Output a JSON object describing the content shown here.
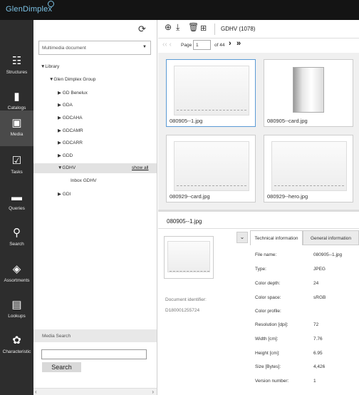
{
  "app": {
    "brand": "GlenDimplex"
  },
  "nav": {
    "items": [
      {
        "label": "Structures",
        "icon": "structures-icon"
      },
      {
        "label": "Catalogs",
        "icon": "catalogs-icon"
      },
      {
        "label": "Media",
        "icon": "media-icon"
      },
      {
        "label": "Tasks",
        "icon": "tasks-icon"
      },
      {
        "label": "Queries",
        "icon": "queries-icon"
      },
      {
        "label": "Search",
        "icon": "search-icon"
      },
      {
        "label": "Assortments",
        "icon": "assortments-icon"
      },
      {
        "label": "Lookups",
        "icon": "lookups-icon"
      },
      {
        "label": "Characteristic",
        "icon": "characteristic-icon"
      }
    ],
    "active": "Media"
  },
  "tree": {
    "doc_type": "Multimedia document",
    "nodes": {
      "library": "▼Library",
      "glen": "▼Glen Dimplex Group",
      "benelux": "▶ GD Benelux",
      "gda": "▶ GDA",
      "gdcaha": "▶ GDCAHA",
      "gdcamr": "▶ GDCAMR",
      "gdcarr": "▶ GDCARR",
      "gdd": "▶ GDD",
      "gdhv": "▼GDHV",
      "inbox": "Inbox GDHV",
      "gdi": "▶ GDI"
    },
    "show_all": "show all"
  },
  "search": {
    "header": "Media Search",
    "button": "Search",
    "value": ""
  },
  "toolbar": {
    "title": "GDHV (1078)"
  },
  "pager": {
    "page_label": "Page",
    "page": "1",
    "of": "of 44"
  },
  "thumbs": [
    {
      "label": "080905--1.jpg",
      "selected": true
    },
    {
      "label": "080905--card.jpg",
      "selected": false
    },
    {
      "label": "080929--card.jpg",
      "selected": false
    },
    {
      "label": "080929--hero.jpg",
      "selected": false
    }
  ],
  "detail": {
    "title": "080905--1.jpg",
    "doc_id_label": "Document identifier:",
    "doc_id": "D180001255724",
    "tab_technical": "Technical information",
    "tab_general": "General information",
    "props": [
      {
        "label": "File name:",
        "value": "080905--1.jpg"
      },
      {
        "label": "Type:",
        "value": "JPEG"
      },
      {
        "label": "Color depth:",
        "value": "24"
      },
      {
        "label": "Color space:",
        "value": "sRGB"
      },
      {
        "label": "Color profile:",
        "value": ""
      },
      {
        "label": "Resolution [dpi]:",
        "value": "72"
      },
      {
        "label": "Width [cm]:",
        "value": "7.76"
      },
      {
        "label": "Height [cm]:",
        "value": "6.95"
      },
      {
        "label": "Size [Bytes]:",
        "value": "4,426"
      },
      {
        "label": "Version number:",
        "value": "1"
      }
    ]
  }
}
